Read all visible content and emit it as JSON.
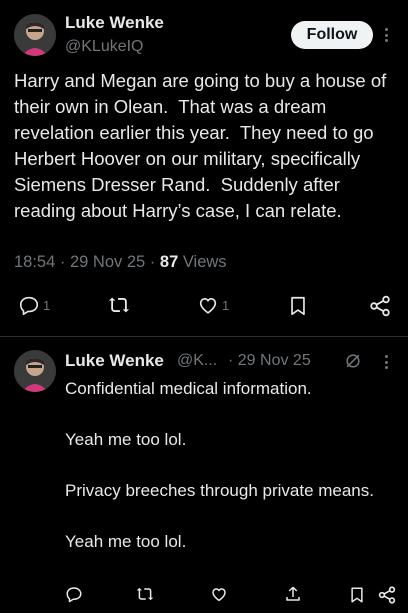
{
  "post": {
    "author_name": "Luke Wenke",
    "author_handle": "@KLukeIQ",
    "follow_label": "Follow",
    "text": "Harry and Megan are going to buy a house of their own in Olean.  That was a dream revelation earlier this year.  They need to go Herbert Hoover on our military, specifically Siemens Dresser Rand.  Suddenly after reading about Harry’s case, I can relate.",
    "time": "18:54",
    "date": "29 Nov 25",
    "views_count": "87",
    "views_label": "Views",
    "reply_count": "1",
    "like_count": "1"
  },
  "reply": {
    "author_name": "Luke Wenke",
    "author_handle": "@K...",
    "date": "· 29 Nov 25",
    "text": "Confidential medical information.\n\nYeah me too lol.\n\nPrivacy breeches through private means.\n\nYeah me too lol."
  },
  "icons": {
    "reply": "comment-icon",
    "repost": "repost-icon",
    "like": "heart-icon",
    "bookmark": "bookmark-icon",
    "share": "share-icon",
    "more": "more-vertical-icon",
    "grok": "grok-icon",
    "upload": "upload-icon"
  },
  "colors": {
    "background": "#000000",
    "primary_text": "#e7e9ea",
    "secondary_text": "#71767b",
    "follow_button_bg": "#eff3f4",
    "divider": "#2f3336"
  }
}
